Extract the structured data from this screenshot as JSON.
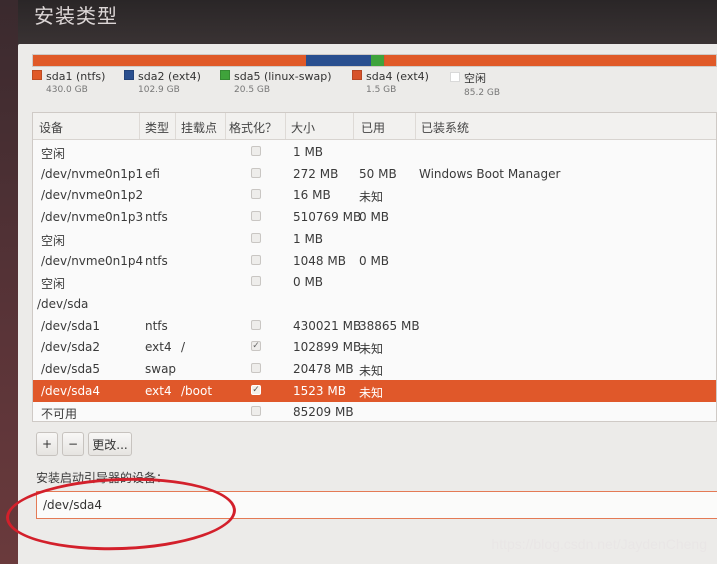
{
  "window": {
    "title": "安装类型"
  },
  "colors": {
    "ntfs": "#e05a28",
    "ext4_sda2": "#2a4f8f",
    "swap": "#3fa33b",
    "ext4_sda4": "#d7532b",
    "free": "#f5f5f5",
    "selected_row": "#e0582a",
    "annotation": "#d3202b"
  },
  "usage_bar": {
    "segments": [
      {
        "name": "sda1",
        "fraction": 0.3996,
        "color": "#e05a28"
      },
      {
        "name": "sda2",
        "fraction": 0.0956,
        "color": "#2a4f8f"
      },
      {
        "name": "sda5",
        "fraction": 0.019,
        "color": "#3fa33b"
      },
      {
        "name": "sda4",
        "fraction": 0.0014,
        "color": "#d7532b"
      },
      {
        "name": "free",
        "fraction": 0.4844,
        "color": "#e05a28"
      }
    ]
  },
  "legend": [
    {
      "label": "sda1 (ntfs)",
      "size": "430.0 GB",
      "color": "#e05a28"
    },
    {
      "label": "sda2 (ext4)",
      "size": "102.9 GB",
      "color": "#2a4f8f"
    },
    {
      "label": "sda5 (linux-swap)",
      "size": "20.5 GB",
      "color": "#3fa33b"
    },
    {
      "label": "sda4 (ext4)",
      "size": "1.5 GB",
      "color": "#d7532b"
    },
    {
      "label": "空闲",
      "size": "85.2 GB",
      "color": "#ffffff"
    }
  ],
  "table": {
    "columns": [
      "设备",
      "类型",
      "挂载点",
      "格式化？",
      "大小",
      "已用",
      "已装系统"
    ],
    "rows": [
      {
        "device": "空闲",
        "type": "",
        "mount": "",
        "format": false,
        "size": "1 MB",
        "used": "",
        "system": ""
      },
      {
        "device": "/dev/nvme0n1p1",
        "type": "efi",
        "mount": "",
        "format": false,
        "size": "272 MB",
        "used": "50 MB",
        "system": "Windows Boot Manager"
      },
      {
        "device": "/dev/nvme0n1p2",
        "type": "",
        "mount": "",
        "format": false,
        "size": "16 MB",
        "used": "未知",
        "system": ""
      },
      {
        "device": "/dev/nvme0n1p3",
        "type": "ntfs",
        "mount": "",
        "format": false,
        "size": "510769 MB",
        "used": "0 MB",
        "system": ""
      },
      {
        "device": "空闲",
        "type": "",
        "mount": "",
        "format": false,
        "size": "1 MB",
        "used": "",
        "system": ""
      },
      {
        "device": "/dev/nvme0n1p4",
        "type": "ntfs",
        "mount": "",
        "format": false,
        "size": "1048 MB",
        "used": "0 MB",
        "system": ""
      },
      {
        "device": "空闲",
        "type": "",
        "mount": "",
        "format": false,
        "size": "0 MB",
        "used": "",
        "system": ""
      },
      {
        "device": "/dev/sda",
        "type": "",
        "mount": "",
        "format": null,
        "size": "",
        "used": "",
        "system": "",
        "group": true
      },
      {
        "device": "/dev/sda1",
        "type": "ntfs",
        "mount": "",
        "format": false,
        "size": "430021 MB",
        "used": "38865 MB",
        "system": ""
      },
      {
        "device": "/dev/sda2",
        "type": "ext4",
        "mount": "/",
        "format": true,
        "size": "102899 MB",
        "used": "未知",
        "system": ""
      },
      {
        "device": "/dev/sda5",
        "type": "swap",
        "mount": "",
        "format": false,
        "size": "20478 MB",
        "used": "未知",
        "system": ""
      },
      {
        "device": "/dev/sda4",
        "type": "ext4",
        "mount": "/boot",
        "format": true,
        "size": "1523 MB",
        "used": "未知",
        "system": "",
        "selected": true
      },
      {
        "device": "不可用",
        "type": "",
        "mount": "",
        "format": false,
        "size": "85209 MB",
        "used": "",
        "system": ""
      }
    ]
  },
  "buttons": {
    "add": "+",
    "remove": "−",
    "change": "更改..."
  },
  "boot_loader": {
    "label": "安装启动引导器的设备：",
    "value": "/dev/sda4"
  },
  "watermark": "https://blog.csdn.net/JaydenCheng"
}
